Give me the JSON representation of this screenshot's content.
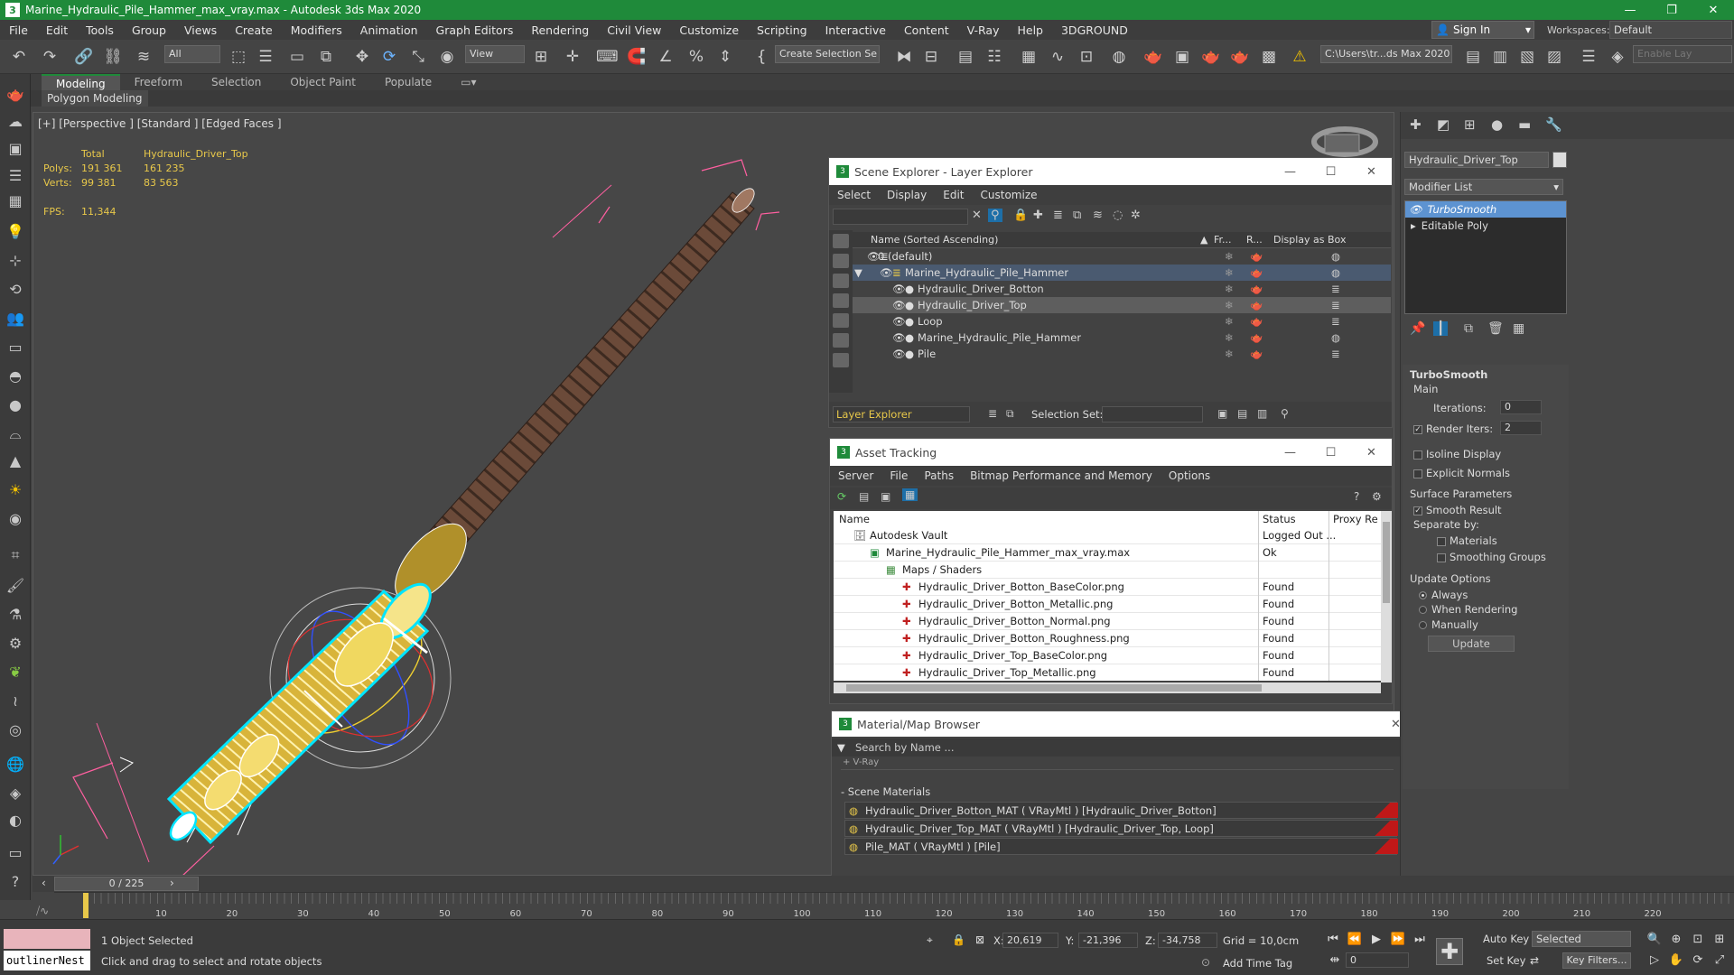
{
  "app": {
    "title": "Marine_Hydraulic_Pile_Hammer_max_vray.max - Autodesk 3ds Max 2020",
    "min": "—",
    "max": "❐",
    "close": "✕",
    "icon": "3"
  },
  "menu": [
    "File",
    "Edit",
    "Tools",
    "Group",
    "Views",
    "Create",
    "Modifiers",
    "Animation",
    "Graph Editors",
    "Rendering",
    "Civil View",
    "Customize",
    "Scripting",
    "Interactive",
    "Content",
    "V-Ray",
    "Help",
    "3DGROUND"
  ],
  "account": {
    "signin": "Sign In",
    "workspaces_label": "Workspaces:",
    "workspace": "Default"
  },
  "toolbar": {
    "filter": "All",
    "view": "View",
    "selection_set": "Create Selection Se",
    "path": "C:\\Users\\tr...ds Max 2020",
    "enable_layer": "Enable Lay"
  },
  "ribbon": {
    "tabs": [
      "Modeling",
      "Freeform",
      "Selection",
      "Object Paint",
      "Populate"
    ],
    "panel": "Polygon Modeling"
  },
  "viewport": {
    "label": "[+] [Perspective ] [Standard ] [Edged Faces ]",
    "stats": {
      "total": "Total",
      "object": "Hydraulic_Driver_Top",
      "polys_label": "Polys:",
      "polys_total": "191 361",
      "polys_obj": "161 235",
      "verts_label": "Verts:",
      "verts_total": "99 381",
      "verts_obj": "83 563",
      "fps_label": "FPS:",
      "fps": "11,344"
    }
  },
  "scene_explorer": {
    "title": "Scene Explorer - Layer Explorer",
    "menu": [
      "Select",
      "Display",
      "Edit",
      "Customize"
    ],
    "columns": [
      "Name (Sorted Ascending)",
      "Fr...",
      "R...",
      "Display as Box"
    ],
    "rows": [
      {
        "name": "0 (default)",
        "indent": 0
      },
      {
        "name": "Marine_Hydraulic_Pile_Hammer",
        "indent": 1,
        "selected": true
      },
      {
        "name": "Hydraulic_Driver_Botton",
        "indent": 2
      },
      {
        "name": "Hydraulic_Driver_Top",
        "indent": 2,
        "highlight": true
      },
      {
        "name": "Loop",
        "indent": 2
      },
      {
        "name": "Marine_Hydraulic_Pile_Hammer",
        "indent": 2
      },
      {
        "name": "Pile",
        "indent": 2
      }
    ],
    "footer_left": "Layer Explorer",
    "selection_set_label": "Selection Set:"
  },
  "asset_tracking": {
    "title": "Asset Tracking",
    "menu": [
      "Server",
      "File",
      "Paths",
      "Bitmap Performance and Memory",
      "Options"
    ],
    "columns": [
      "Name",
      "Status",
      "Proxy Re"
    ],
    "rows": [
      {
        "name": "Autodesk Vault",
        "status": "Logged Out ...",
        "indent": 1
      },
      {
        "name": "Marine_Hydraulic_Pile_Hammer_max_vray.max",
        "status": "Ok",
        "indent": 2
      },
      {
        "name": "Maps / Shaders",
        "status": "",
        "indent": 3
      },
      {
        "name": "Hydraulic_Driver_Botton_BaseColor.png",
        "status": "Found",
        "indent": 4
      },
      {
        "name": "Hydraulic_Driver_Botton_Metallic.png",
        "status": "Found",
        "indent": 4
      },
      {
        "name": "Hydraulic_Driver_Botton_Normal.png",
        "status": "Found",
        "indent": 4
      },
      {
        "name": "Hydraulic_Driver_Botton_Roughness.png",
        "status": "Found",
        "indent": 4
      },
      {
        "name": "Hydraulic_Driver_Top_BaseColor.png",
        "status": "Found",
        "indent": 4
      },
      {
        "name": "Hydraulic_Driver_Top_Metallic.png",
        "status": "Found",
        "indent": 4
      }
    ]
  },
  "material_browser": {
    "title": "Material/Map Browser",
    "search": "Search by Name ...",
    "vray": "+ V-Ray",
    "section": "- Scene Materials",
    "materials": [
      "Hydraulic_Driver_Botton_MAT ( VRayMtl ) [Hydraulic_Driver_Botton]",
      "Hydraulic_Driver_Top_MAT ( VRayMtl ) [Hydraulic_Driver_Top, Loop]",
      "Pile_MAT ( VRayMtl ) [Pile]"
    ]
  },
  "command_panel": {
    "object_name": "Hydraulic_Driver_Top",
    "modifier_list": "Modifier List",
    "stack": [
      "TurboSmooth",
      "Editable Poly"
    ],
    "rollout": "TurboSmooth",
    "main": "Main",
    "iterations_label": "Iterations:",
    "iterations": "0",
    "render_iters_label": "Render Iters:",
    "render_iters": "2",
    "isoline": "Isoline Display",
    "explicit_normals": "Explicit Normals",
    "surface_params": "Surface Parameters",
    "smooth_result": "Smooth Result",
    "separate_by": "Separate by:",
    "materials": "Materials",
    "smoothing_groups": "Smoothing Groups",
    "update_options": "Update Options",
    "always": "Always",
    "when_rendering": "When Rendering",
    "manually": "Manually",
    "update": "Update"
  },
  "timeline": {
    "frame": "0 / 225",
    "ticks": [
      "10",
      "20",
      "30",
      "40",
      "50",
      "60",
      "70",
      "80",
      "90",
      "100",
      "110",
      "120",
      "130",
      "140",
      "150",
      "160",
      "170",
      "180",
      "190",
      "200",
      "210",
      "220"
    ]
  },
  "status": {
    "script": "outlinerNest",
    "selected": "1 Object Selected",
    "prompt": "Click and drag to select and rotate objects",
    "x_label": "X:",
    "x": "20,619",
    "y_label": "Y:",
    "y": "-21,396",
    "z_label": "Z:",
    "z": "-34,758",
    "grid": "Grid = 10,0cm",
    "add_time_tag": "Add Time Tag",
    "auto_key": "Auto Key",
    "set_key": "Set Key",
    "selected_mode": "Selected",
    "key_filters": "Key Filters...",
    "frame_field": "0"
  }
}
